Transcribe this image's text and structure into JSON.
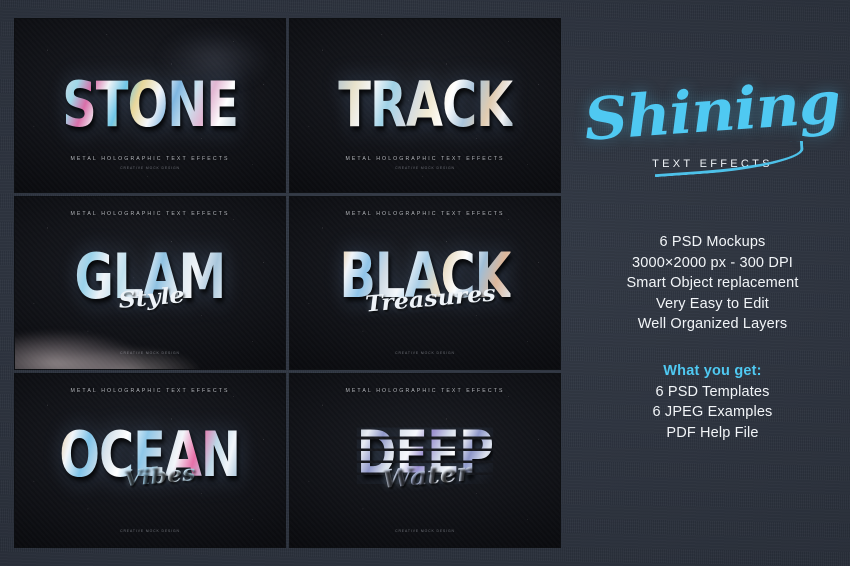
{
  "theme": {
    "accent_cyan": "#4fc9f2",
    "panel_bg": "#2b313c",
    "tile_bg": "#070709",
    "text_white": "#f2f5f8"
  },
  "brand": {
    "script_name": "Shining",
    "subtitle": "TEXT EFFECTS"
  },
  "features": [
    "6 PSD Mockups",
    "3000×2000 px - 300 DPI",
    "Smart Object replacement",
    "Very Easy to Edit",
    "Well Organized Layers"
  ],
  "what_you_get": {
    "title": "What you get:",
    "items": [
      "6 PSD Templates",
      "6 JPEG Examples",
      "PDF Help File"
    ]
  },
  "mockups": [
    {
      "id": "stone",
      "word": "STONE",
      "script": "",
      "caption": "METAL HOLOGRAPHIC TEXT EFFECTS",
      "subcaption": "CREATIVE MOCK DESIGN",
      "caption_position": "bottom"
    },
    {
      "id": "track",
      "word": "TRACK",
      "script": "",
      "caption": "METAL HOLOGRAPHIC TEXT EFFECTS",
      "subcaption": "CREATIVE MOCK DESIGN",
      "caption_position": "bottom"
    },
    {
      "id": "glam",
      "word": "GLAM",
      "script": "Style",
      "caption": "METAL HOLOGRAPHIC TEXT EFFECTS",
      "subcaption": "CREATIVE MOCK DESIGN",
      "caption_position": "top"
    },
    {
      "id": "black",
      "word": "BLACK",
      "script": "Treasures",
      "caption": "METAL HOLOGRAPHIC TEXT EFFECTS",
      "subcaption": "CREATIVE MOCK DESIGN",
      "caption_position": "top"
    },
    {
      "id": "ocean",
      "word": "OCEAN",
      "script": "Vibes",
      "caption": "METAL HOLOGRAPHIC TEXT EFFECTS",
      "subcaption": "CREATIVE MOCK DESIGN",
      "caption_position": "top"
    },
    {
      "id": "deep",
      "word": "DEEP",
      "script": "Water",
      "caption": "METAL HOLOGRAPHIC TEXT EFFECTS",
      "subcaption": "CREATIVE MOCK DESIGN",
      "caption_position": "top"
    }
  ]
}
